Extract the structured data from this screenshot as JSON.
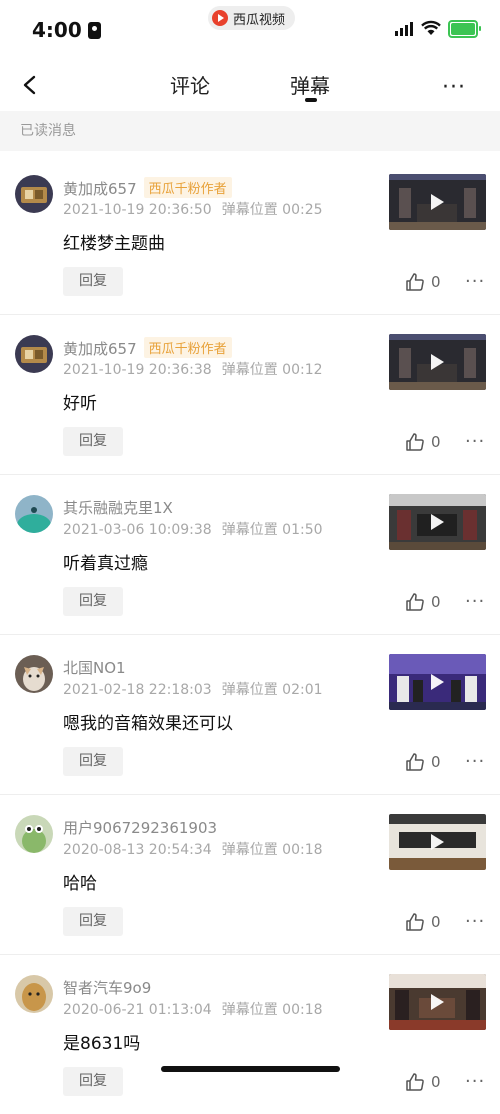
{
  "status_bar": {
    "time": "4:00",
    "app_name": "西瓜视频"
  },
  "nav": {
    "tab_comment": "评论",
    "tab_danmaku": "弹幕",
    "active_tab": "弹幕",
    "more": "···"
  },
  "read_bar": {
    "label": "已读消息"
  },
  "position_label": "弹幕位置",
  "reply_label": "回复",
  "items": [
    {
      "name": "黄加成657",
      "badge": "西瓜千粉作者",
      "date": "2021-10-19 20:36:50",
      "pos": "00:25",
      "content": "红楼梦主题曲",
      "likes": "0"
    },
    {
      "name": "黄加成657",
      "badge": "西瓜千粉作者",
      "date": "2021-10-19 20:36:38",
      "pos": "00:12",
      "content": "好听",
      "likes": "0"
    },
    {
      "name": "其乐融融克里1X",
      "badge": "",
      "date": "2021-03-06 10:09:38",
      "pos": "01:50",
      "content": "听着真过瘾",
      "likes": "0"
    },
    {
      "name": "北国NO1",
      "badge": "",
      "date": "2021-02-18 22:18:03",
      "pos": "02:01",
      "content": "嗯我的音箱效果还可以",
      "likes": "0"
    },
    {
      "name": "用户9067292361903",
      "badge": "",
      "date": "2020-08-13 20:54:34",
      "pos": "00:18",
      "content": "哈哈",
      "likes": "0"
    },
    {
      "name": "智者汽车9o9",
      "badge": "",
      "date": "2020-06-21 01:13:04",
      "pos": "00:18",
      "content": "是8631吗",
      "likes": "0"
    }
  ],
  "colors": {
    "badge_text": "#e8a23a",
    "badge_bg": "#fdf3e3",
    "battery": "#3cc453",
    "app_logo": "#e8412c"
  }
}
